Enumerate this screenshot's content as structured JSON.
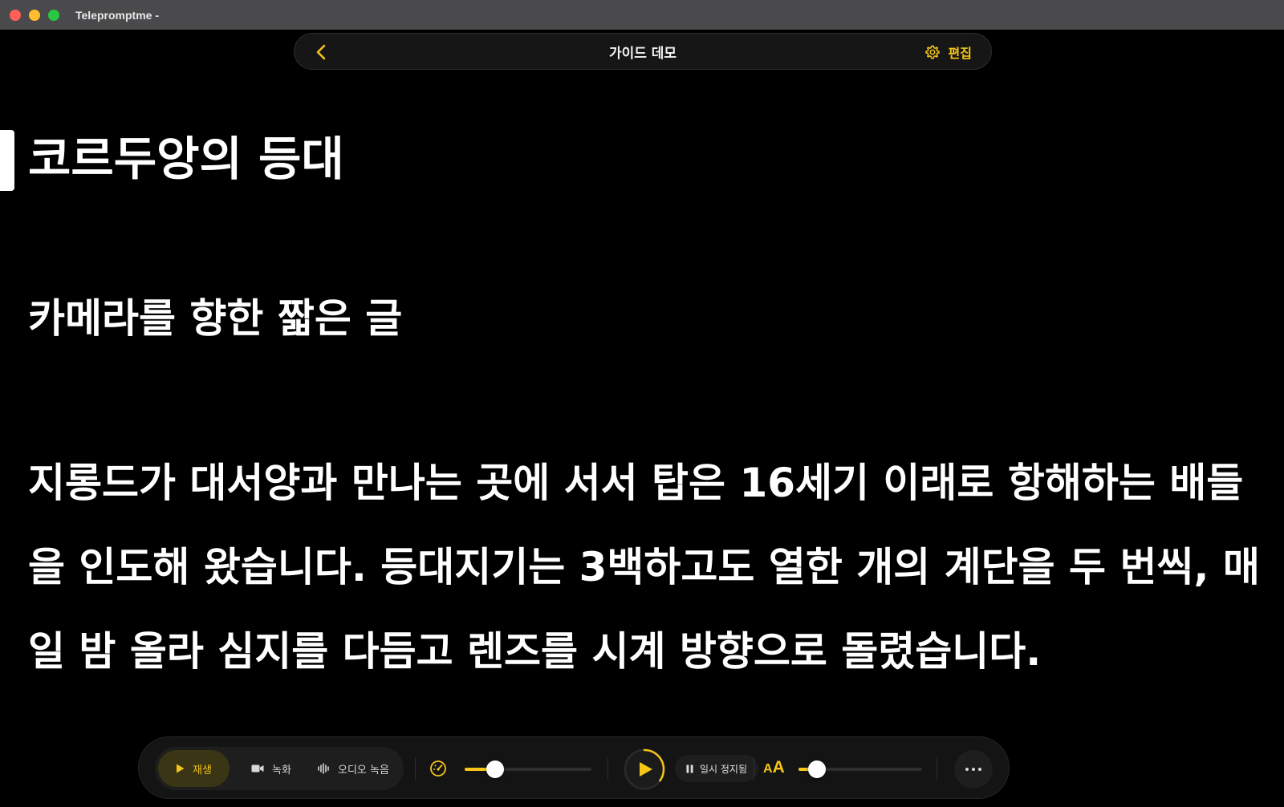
{
  "window": {
    "title": "Telepromptme -"
  },
  "topbar": {
    "title": "가이드 데모",
    "edit_label": "편집"
  },
  "script": {
    "heading": "코르두앙의 등대",
    "subheading": "카메라를 향한 짧은 글",
    "paragraph": "지롱드가 대서양과 만나는 곳에 서서 탑은 16세기 이래로 항해하는 배들을 인도해 왔습니다. 등대지기는 3백하고도 열한 개의 계단을 두 번씩, 매일 밤 올라 심지를 다듬고 렌즈를 시계 방향으로 돌렸습니다."
  },
  "controls": {
    "modes": [
      {
        "label": "재생",
        "icon": "play-icon",
        "active": true
      },
      {
        "label": "녹화",
        "icon": "video-camera-icon",
        "active": false
      },
      {
        "label": "오디오 녹음",
        "icon": "waveform-icon",
        "active": false
      }
    ],
    "speed_slider": 0.24,
    "playback_ring_progress": 0.35,
    "status_label": "일시 정지됨",
    "font_size_icon": "AA",
    "font_size_slider": 0.15
  },
  "colors": {
    "accent": "#f5c518",
    "background": "#000000",
    "titlebar": "#4a4a4c"
  }
}
